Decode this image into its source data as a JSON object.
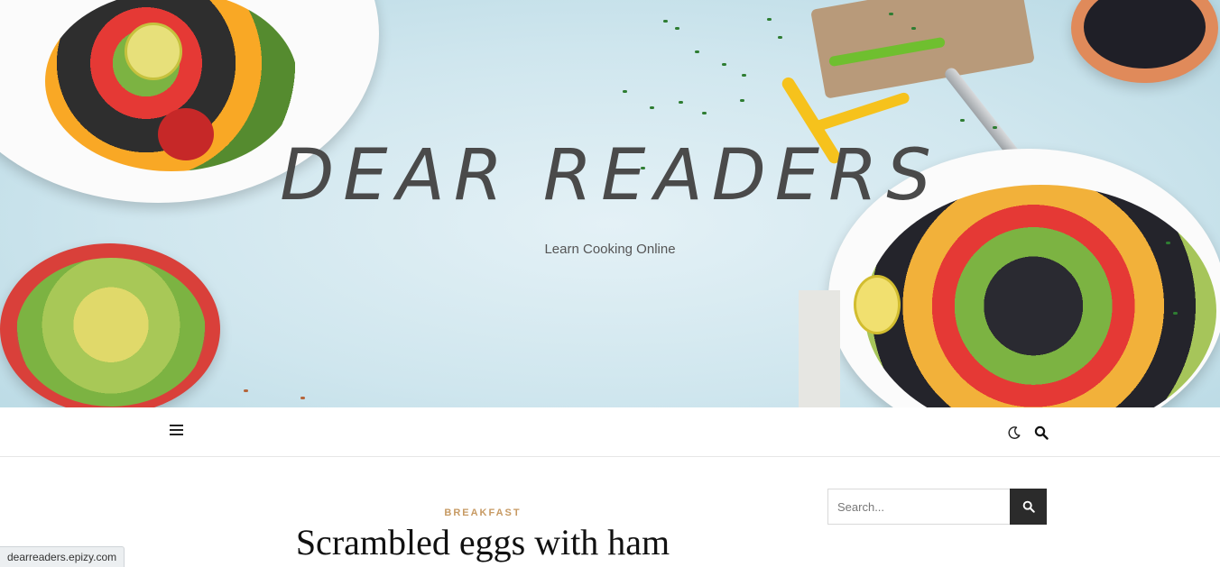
{
  "header": {
    "site_title": "DEAR READERS",
    "tagline": "Learn Cooking Online"
  },
  "navbar": {
    "menu_icon": "hamburger-icon",
    "dark_mode_icon": "moon-icon",
    "search_icon": "search-icon"
  },
  "post": {
    "category": "BREAKFAST",
    "title": "Scrambled eggs with ham"
  },
  "sidebar": {
    "search": {
      "placeholder": "Search...",
      "button_icon": "search-icon"
    }
  },
  "status_bar": {
    "url": "dearreaders.epizy.com"
  },
  "colors": {
    "accent": "#c79a63",
    "hero_background": "#cfe6ee",
    "search_button": "#2b2b2b"
  }
}
